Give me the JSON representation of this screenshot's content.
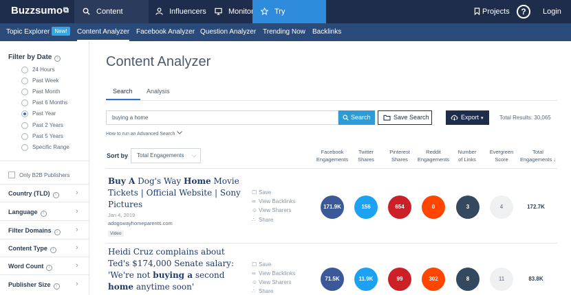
{
  "app": {
    "logo": "Buzzsumo",
    "logo_icon": "wifi-icon"
  },
  "topnav": {
    "content_research": "Content Research",
    "influencers": "Influencers",
    "monitoring": "Monitoring",
    "try_pro": "Try BuzzSumo Pro",
    "projects": "Projects",
    "help": "?",
    "login": "Login"
  },
  "subnav": {
    "topic_explorer": "Topic Explorer",
    "new_badge": "New!",
    "content_analyzer": "Content Analyzer",
    "facebook_analyzer": "Facebook Analyzer",
    "question_analyzer": "Question Analyzer",
    "trending_now": "Trending Now",
    "backlinks": "Backlinks"
  },
  "sidebar": {
    "filter_by_date": "Filter by Date",
    "date_options": [
      "24 Hours",
      "Past Week",
      "Past Month",
      "Past 6 Months",
      "Past Year",
      "Past 2 Years",
      "Past 5 Years",
      "Specific Range"
    ],
    "selected_date_index": 4,
    "b2b": "Only B2B Publishers",
    "filters": [
      "Country (TLD)",
      "Language",
      "Filter Domains",
      "Content Type",
      "Word Count",
      "Publisher Size"
    ]
  },
  "main": {
    "title": "Content Analyzer",
    "tabs": [
      "Search",
      "Analysis"
    ],
    "search_value": "buying a home",
    "search_button": "Search",
    "save_search": "Save Search",
    "export": "Export",
    "total_results": "Total Results: 30,065",
    "advanced_link": "How to run an Advanced Search",
    "sort_by": "Sort by",
    "sort_value": "Total Engagements",
    "columns": [
      [
        "Facebook",
        "Engagements"
      ],
      [
        "Twitter",
        "Shares"
      ],
      [
        "Pinterest",
        "Shares"
      ],
      [
        "Reddit",
        "Engagements"
      ],
      [
        "Number",
        "of Links"
      ],
      [
        "Evergreen",
        "Score"
      ],
      [
        "Total",
        "Engagements ↓"
      ]
    ],
    "actions": [
      "Save",
      "View Backlinks",
      "View Sharers",
      "Share"
    ]
  },
  "colors": {
    "facebook": "#3b5998",
    "twitter": "#1da1f2",
    "pinterest": "#cb2027",
    "reddit": "#ff4500",
    "links": "#34495e",
    "evergreen": "#eef0f2"
  },
  "results": [
    {
      "title_parts": [
        {
          "t": "Buy A",
          "b": true
        },
        {
          "t": " Dog's Way ",
          "b": false
        },
        {
          "t": "Home",
          "b": true
        },
        {
          "t": " Movie Tickets | Official Website | Sony Pictures",
          "b": false
        }
      ],
      "date": "Jan 4, 2019",
      "domain": "adogswayhomeparents.com",
      "badge": "Video",
      "facebook": "171.9K",
      "twitter": "156",
      "pinterest": "654",
      "reddit": "0",
      "links": "3",
      "evergreen": "4",
      "total": "172.7K"
    },
    {
      "title_parts": [
        {
          "t": "Heidi Cruz complains about Ted's $174,000 Senate salary: 'We're not ",
          "b": false
        },
        {
          "t": "buying a",
          "b": true
        },
        {
          "t": " second ",
          "b": false
        },
        {
          "t": "home",
          "b": true
        },
        {
          "t": " anytime soon'",
          "b": false
        }
      ],
      "facebook": "71.5K",
      "twitter": "11.9K",
      "pinterest": "99",
      "reddit": "302",
      "links": "8",
      "evergreen": "11",
      "total": "83.8K"
    }
  ]
}
